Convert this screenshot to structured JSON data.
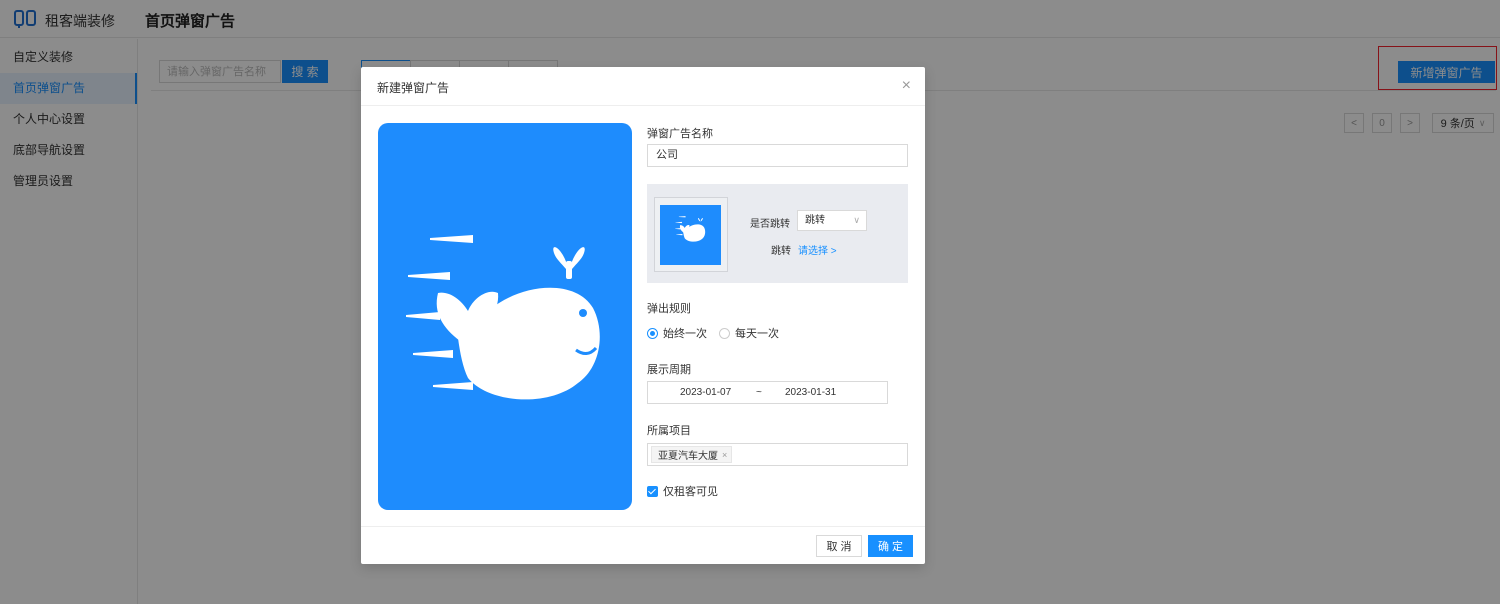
{
  "header": {
    "app_name": "租客端装修",
    "page_title": "首页弹窗广告"
  },
  "sidebar": {
    "items": [
      {
        "label": "自定义装修"
      },
      {
        "label": "首页弹窗广告"
      },
      {
        "label": "个人中心设置"
      },
      {
        "label": "底部导航设置"
      },
      {
        "label": "管理员设置"
      }
    ]
  },
  "main": {
    "search_placeholder": "请输入弹窗广告名称",
    "search_button": "搜 索",
    "add_button": "新增弹窗广告",
    "pager": {
      "prev": "<",
      "page": "0",
      "next": ">",
      "page_size": "9 条/页"
    }
  },
  "modal": {
    "title": "新建弹窗广告",
    "close": "×",
    "name_label": "弹窗广告名称",
    "name_value": "公司",
    "jump_label": "是否跳转",
    "jump_select": "跳转",
    "jump2_label": "跳转",
    "jump_link": "请选择 >",
    "rule_label": "弹出规则",
    "rule_options": [
      "始终一次",
      "每天一次"
    ],
    "rule_selected": "始终一次",
    "period_label": "展示周期",
    "period_start": "2023-01-07",
    "period_sep": "~",
    "period_end": "2023-01-31",
    "project_label": "所属项目",
    "project_tag": "亚夏汽车大厦",
    "tenant_visible_label": "仅租客可见",
    "tenant_visible_checked": true,
    "cancel_button": "取 消",
    "ok_button": "确 定"
  },
  "colors": {
    "primary": "#1890ff",
    "preview_bg": "#1e8cfd",
    "highlight_border": "#f5222d"
  }
}
